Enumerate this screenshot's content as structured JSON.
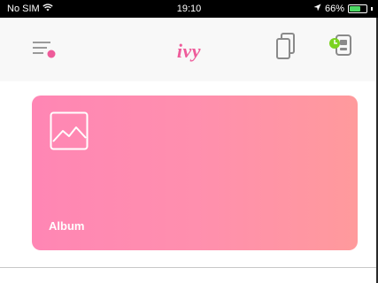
{
  "status_bar": {
    "carrier": "No SIM",
    "time": "19:10",
    "battery_percent": "66%",
    "battery_level": 0.66,
    "icons": [
      "wifi-icon",
      "location-arrow-icon",
      "battery-icon"
    ]
  },
  "nav": {
    "logo_text": "ivy",
    "icons": [
      "menu-icon",
      "copy-icon",
      "printer-connect-icon"
    ],
    "accent_color": "#ee5b9a",
    "notification_dot_color": "#ee5b9a",
    "printer_indicator_color": "#7bd321"
  },
  "album_card": {
    "label": "Album",
    "icon": "image-icon",
    "gradient_colors": [
      "#ff86b4",
      "#ff9a9c"
    ]
  }
}
